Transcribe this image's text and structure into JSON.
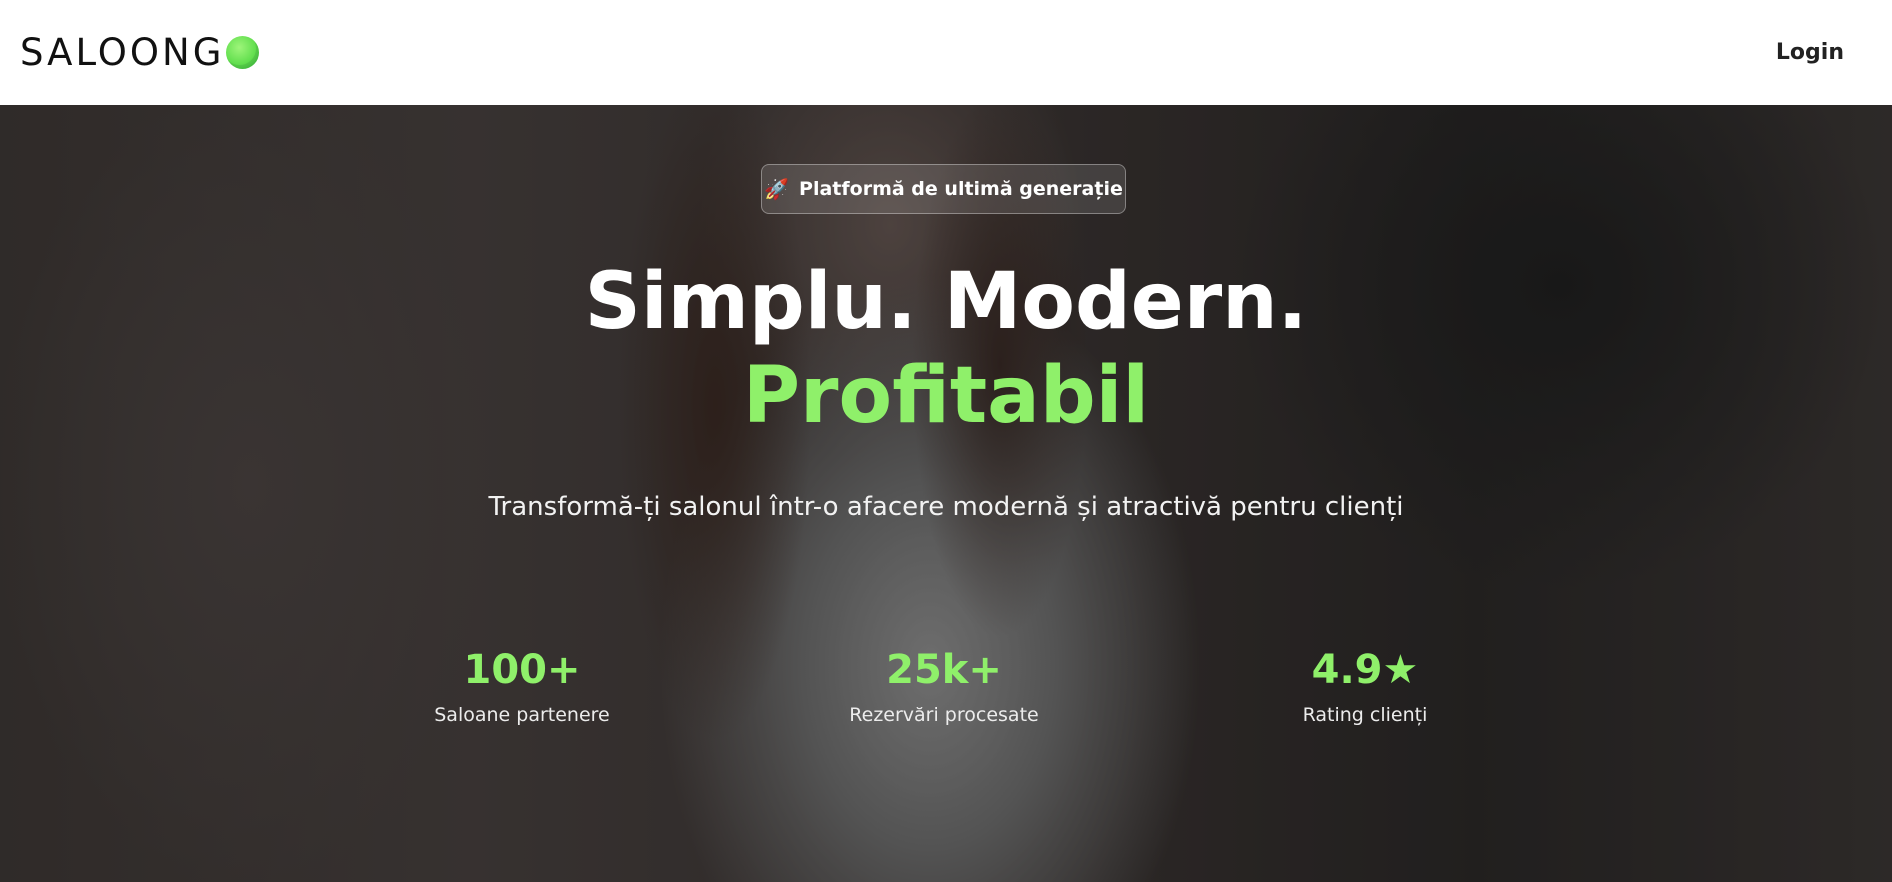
{
  "header": {
    "logo_text": "SALOONG",
    "login_label": "Login"
  },
  "hero": {
    "badge_icon": "rocket-icon",
    "badge_emoji": "🚀",
    "badge_text": "Platformă de ultimă generație",
    "headline_line1": "Simplu. Modern.",
    "headline_line2": "Profitabil",
    "subtitle": "Transformă-ți salonul într-o afacere modernă și atractivă pentru clienți",
    "stats": [
      {
        "value": "100+",
        "label": "Saloane partenere"
      },
      {
        "value": "25k+",
        "label": "Rezervări procesate"
      },
      {
        "value": "4.9★",
        "label": "Rating clienți"
      }
    ]
  },
  "colors": {
    "accent_green": "#8ff06a",
    "header_bg": "#ffffff",
    "text_dark": "#111111"
  }
}
